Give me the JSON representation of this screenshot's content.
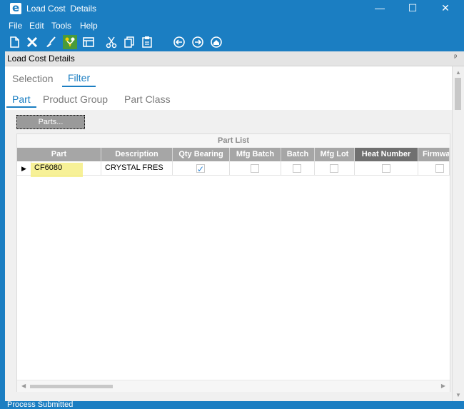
{
  "window": {
    "title": "Load Cost  Details",
    "controls": {
      "minimize": "—",
      "maximize": "☐",
      "close": "✕"
    }
  },
  "menu": [
    "File",
    "Edit",
    "Tools",
    "Help"
  ],
  "toolbar": {
    "icons": [
      "new-icon",
      "delete-icon",
      "clear-icon",
      "process-icon",
      "view-icon",
      "cut-icon",
      "copy-icon",
      "paste-icon",
      "back-icon",
      "forward-icon",
      "home-icon"
    ],
    "active_icon": "process-icon"
  },
  "panel": {
    "title": "Load Cost Details",
    "pin": "ᵖ"
  },
  "tabs": {
    "top": [
      {
        "label": "Selection",
        "active": false
      },
      {
        "label": "Filter",
        "active": true
      }
    ],
    "sub": [
      {
        "label": "Part",
        "active": true
      },
      {
        "label": "Product Group",
        "active": false
      },
      {
        "label": "Part Class",
        "active": false
      }
    ]
  },
  "parts_button": "Parts...",
  "grid": {
    "caption": "Part List",
    "columns": [
      "Part",
      "Description",
      "Qty Bearing",
      "Mfg Batch",
      "Batch",
      "Mfg Lot",
      "Heat Number",
      "Firmware"
    ],
    "rows": [
      {
        "part": "CF6080",
        "description": "CRYSTAL FRES",
        "qty_bearing": true,
        "mfg_batch": false,
        "batch": false,
        "mfg_lot": false,
        "heat_number": false,
        "firmware": false
      }
    ]
  },
  "colors": {
    "accent": "#1b7ec2",
    "highlight": "#f6ef85",
    "header": "#a6a6a6",
    "header_sorted": "#707070"
  },
  "status": "Process Submitted"
}
